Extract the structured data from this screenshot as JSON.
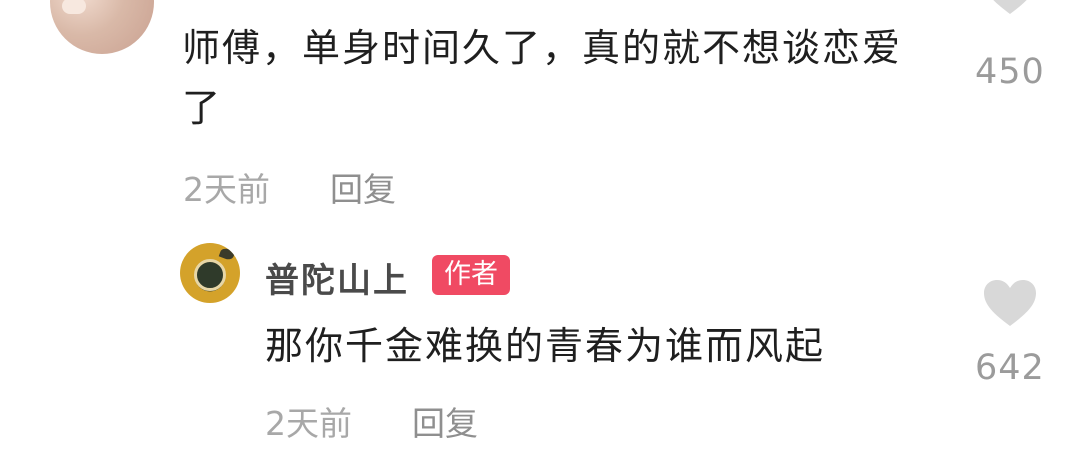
{
  "comments": [
    {
      "text": "师傅，单身时间久了，真的就不想谈恋爱了",
      "time": "2天前",
      "reply": "回复",
      "likes": "450"
    },
    {
      "author": "普陀山上",
      "author_tag": "作者",
      "text": "那你千金难换的青春为谁而风起",
      "time": "2天前",
      "reply": "回复",
      "likes": "642"
    }
  ],
  "icons": {
    "like": "heart-icon",
    "like_color": "#d8d8d8"
  }
}
